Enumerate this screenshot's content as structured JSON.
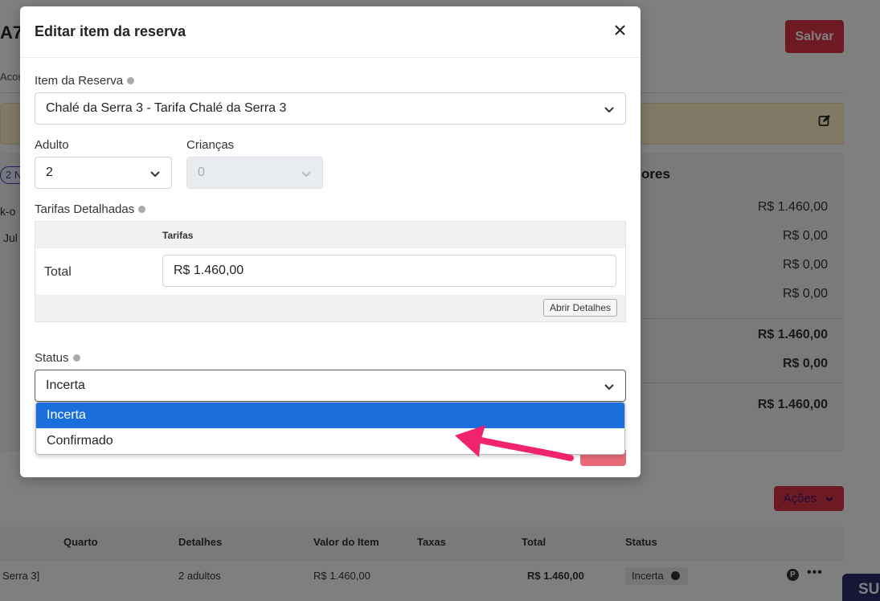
{
  "background": {
    "title_fragment": "A7",
    "save_label": "Salvar",
    "subtitle_fragment": "Acor",
    "badge_fragment": "2 N",
    "label_a_fragment": "k-o",
    "label_b_fragment": "Jul",
    "valores_fragment": "ores",
    "values": [
      "R$ 1.460,00",
      "R$ 0,00",
      "R$ 0,00",
      "R$ 0,00"
    ],
    "subtotal": "R$ 1.460,00",
    "paid": "R$ 0,00",
    "total": "R$ 1.460,00",
    "acoes_label": "Ações",
    "table": {
      "headers": [
        "Quarto",
        "Detalhes",
        "Valor do Item",
        "Taxas",
        "Total",
        "Status"
      ],
      "row": {
        "quarto": "Serra 3]",
        "detalhes": "2 adultos",
        "valor": "R$ 1.460,00",
        "total": "R$ 1.460,00",
        "status": "Incerta"
      }
    },
    "p_icon": "P",
    "su_fragment": "SU"
  },
  "modal": {
    "title": "Editar item da reserva",
    "item_label": "Item da Reserva",
    "item_value": "Chalé da Serra 3 - Tarifa Chalé da Serra 3",
    "adulto_label": "Adulto",
    "adulto_value": "2",
    "criancas_label": "Crianças",
    "criancas_value": "0",
    "tarifas_label": "Tarifas Detalhadas",
    "tarifas_col": "Tarifas",
    "tarifas_total_label": "Total",
    "tarifas_total_value": "R$ 1.460,00",
    "abrir_detalhes": "Abrir Detalhes",
    "status_label": "Status",
    "status_value": "Incerta"
  },
  "dropdown": {
    "options": [
      "Incerta",
      "Confirmado"
    ],
    "selected_index": 0
  },
  "colors": {
    "accent_red": "#dc3545",
    "selected_blue": "#1a6fdc",
    "arrow_pink": "#f0246e"
  }
}
